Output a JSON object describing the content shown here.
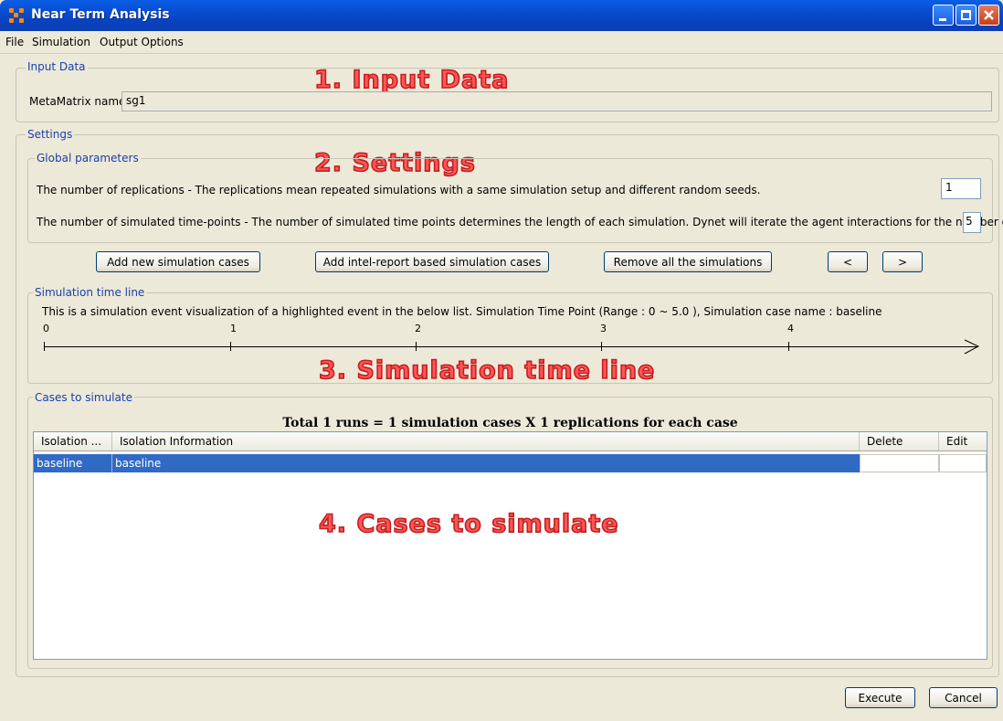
{
  "window": {
    "title": "Near Term Analysis"
  },
  "menu": [
    "File",
    "Simulation",
    "Output Options"
  ],
  "input_data": {
    "legend": "Input Data",
    "overlay": "1. Input Data",
    "metamatrix_label": "MetaMatrix name",
    "metamatrix_value": "sg1"
  },
  "settings": {
    "legend": "Settings",
    "overlay": "2. Settings",
    "global_params": {
      "legend": "Global parameters",
      "replications_label": "The number of replications - The replications mean repeated simulations with a same simulation setup and different random seeds.",
      "replications_value": "1",
      "timepoints_label": "The number of simulated time-points - The number of simulated time points determines the length of each simulation. Dynet will iterate the agent interactions for the number of times",
      "timepoints_value": "5"
    },
    "buttons": {
      "add_new": "Add new simulation cases",
      "add_intel": "Add intel-report based simulation cases",
      "remove_all": "Remove all the simulations",
      "prev": "<",
      "next": ">"
    },
    "timeline": {
      "legend": "Simulation time line",
      "overlay": "3. Simulation time line",
      "description": "This is a simulation event visualization of a highlighted event in the below list. Simulation Time Point (Range : 0 ~ 5.0 ), Simulation case name : baseline",
      "ticks": [
        "0",
        "1",
        "2",
        "3",
        "4"
      ]
    },
    "cases": {
      "legend": "Cases to simulate",
      "overlay": "4. Cases to simulate",
      "summary": "Total 1 runs = 1 simulation cases X 1 replications for each case",
      "columns": [
        "Isolation ...",
        "Isolation Information",
        "Delete",
        "Edit"
      ],
      "rows": [
        {
          "id": "baseline",
          "info": "baseline",
          "delete": "",
          "edit": ""
        }
      ]
    }
  },
  "footer": {
    "execute": "Execute",
    "cancel": "Cancel"
  },
  "colors": {
    "title_bar": "#0a4fd6",
    "selection": "#316ac5",
    "legend_text": "#1a3fae",
    "overlay_text": "#ff5555"
  }
}
